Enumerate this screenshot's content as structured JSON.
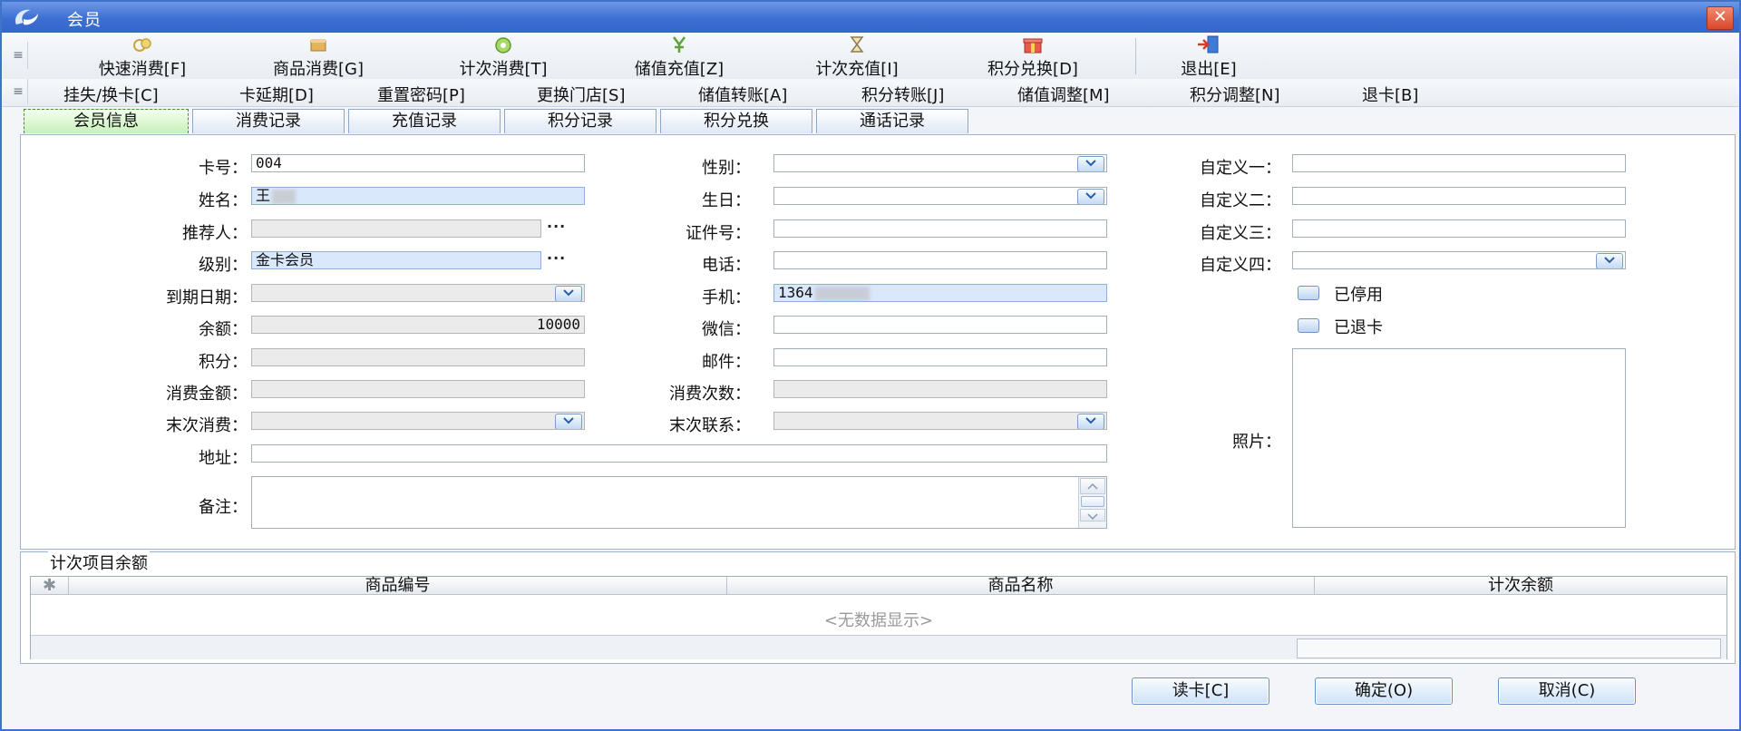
{
  "window": {
    "title": "会员",
    "close_glyph": "✕"
  },
  "colors": {
    "titlebar": "#3d6fd2",
    "highlight_field": "#d9e8fb",
    "active_tab": "#c9f0b9"
  },
  "toolbar": {
    "grip": "≡",
    "buttons": [
      {
        "label": "快速消费[F]",
        "icon": "quick-consume-icon"
      },
      {
        "label": "商品消费[G]",
        "icon": "goods-consume-icon"
      },
      {
        "label": "计次消费[T]",
        "icon": "count-consume-icon"
      },
      {
        "label": "储值充值[Z]",
        "icon": "recharge-icon"
      },
      {
        "label": "计次充值[I]",
        "icon": "count-recharge-icon"
      },
      {
        "label": "积分兑换[D]",
        "icon": "gift-icon"
      },
      {
        "label": "退出[E]",
        "icon": "exit-icon"
      }
    ]
  },
  "toolbar2": {
    "grip": "≡",
    "items": [
      "挂失/换卡[C]",
      "卡延期[D]",
      "重置密码[P]",
      "更换门店[S]",
      "储值转账[A]",
      "积分转账[J]",
      "储值调整[M]",
      "积分调整[N]",
      "退卡[B]"
    ]
  },
  "tabs": [
    "会员信息",
    "消费记录",
    "充值记录",
    "积分记录",
    "积分兑换",
    "通话记录"
  ],
  "form": {
    "card_no": {
      "label": "卡号：",
      "value": "004"
    },
    "name": {
      "label": "姓名：",
      "value": "王"
    },
    "referrer": {
      "label": "推荐人：",
      "value": ""
    },
    "level": {
      "label": "级别：",
      "value": "金卡会员"
    },
    "expiry": {
      "label": "到期日期：",
      "value": ""
    },
    "balance": {
      "label": "余额：",
      "value": "10000"
    },
    "points": {
      "label": "积分：",
      "value": ""
    },
    "consume_amount": {
      "label": "消费金额：",
      "value": ""
    },
    "last_consume": {
      "label": "末次消费：",
      "value": ""
    },
    "address": {
      "label": "地址：",
      "value": ""
    },
    "remark": {
      "label": "备注：",
      "value": ""
    },
    "gender": {
      "label": "性别：",
      "value": ""
    },
    "birthday": {
      "label": "生日：",
      "value": ""
    },
    "id_no": {
      "label": "证件号：",
      "value": ""
    },
    "phone": {
      "label": "电话：",
      "value": ""
    },
    "mobile": {
      "label": "手机：",
      "value": "1364"
    },
    "wechat": {
      "label": "微信：",
      "value": ""
    },
    "email": {
      "label": "邮件：",
      "value": ""
    },
    "consume_count": {
      "label": "消费次数：",
      "value": ""
    },
    "last_contact": {
      "label": "末次联系：",
      "value": ""
    },
    "custom1": {
      "label": "自定义一：",
      "value": ""
    },
    "custom2": {
      "label": "自定义二：",
      "value": ""
    },
    "custom3": {
      "label": "自定义三：",
      "value": ""
    },
    "custom4": {
      "label": "自定义四：",
      "value": ""
    },
    "disabled": {
      "label": "已停用",
      "checked": false
    },
    "refunded": {
      "label": "已退卡",
      "checked": false
    },
    "photo": {
      "label": "照片："
    },
    "ellipsis": "···"
  },
  "count_items": {
    "title": "计次项目余额",
    "columns": [
      "商品编号",
      "商品名称",
      "计次余额"
    ],
    "corner": "✱",
    "empty_text": "<无数据显示>"
  },
  "buttons": {
    "read_card": "读卡[C]",
    "ok": "确定(O)",
    "cancel": "取消(C)"
  }
}
